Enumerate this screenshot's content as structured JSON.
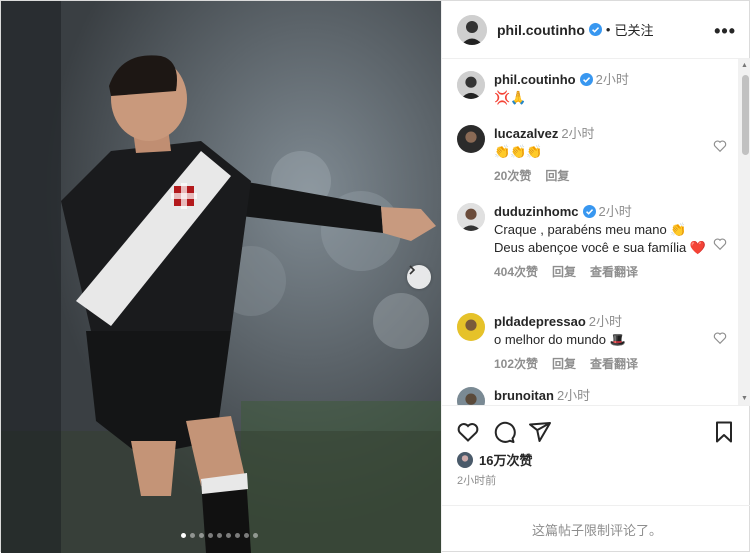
{
  "post_author": {
    "username": "phil.coutinho",
    "separator": "•",
    "follow_status": "已关注",
    "more_label": "•••"
  },
  "caption": {
    "username": "phil.coutinho",
    "time": "2小时",
    "text": "💢🙏"
  },
  "comments": [
    {
      "username": "lucazalvez",
      "time": "2小时",
      "text": "👏👏👏",
      "likes": "20次赞",
      "reply": "回复",
      "translate": ""
    },
    {
      "username": "duduzinhomc",
      "time": "2小时",
      "text": "Craque , parabéns meu mano 👏 Deus abençoe você e sua família ❤️",
      "likes": "404次赞",
      "reply": "回复",
      "translate": "查看翻译"
    },
    {
      "username": "pldadepressao",
      "time": "2小时",
      "text": "o melhor do mundo 🎩",
      "likes": "102次赞",
      "reply": "回复",
      "translate": "查看翻译"
    },
    {
      "username": "brunoitan",
      "time": "2小时",
      "text": "",
      "likes": "",
      "reply": "",
      "translate": ""
    }
  ],
  "engagement": {
    "likes": "16万次赞",
    "time_ago": "2小时前"
  },
  "comment_status": "这篇帖子限制评论了。",
  "carousel": {
    "total": 9,
    "active": 0
  },
  "colors": {
    "verified": "#3897f0",
    "heart": "#ed4956",
    "muted": "#8e8e8e",
    "jersey_sash": "#e8e8e8"
  }
}
